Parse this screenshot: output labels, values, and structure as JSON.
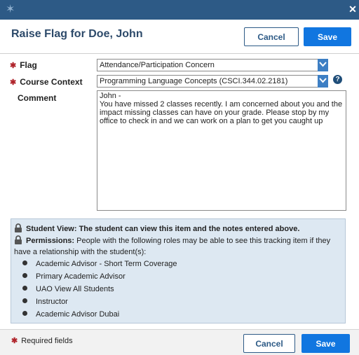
{
  "dialog": {
    "title": "Raise Flag for Doe, John",
    "cancel_label": "Cancel",
    "save_label": "Save"
  },
  "form": {
    "flag_label": "Flag",
    "flag_value": "Attendance/Participation Concern",
    "course_label": "Course Context",
    "course_value": "Programming Language Concepts (CSCI.344.02.2181)",
    "help_glyph": "?",
    "comment_label": "Comment",
    "comment_value": "John -\nYou have missed 2 classes recently. I am concerned about you and the impact missing classes can have on your grade. Please stop by my office to check in and we can work on a plan to get you caught up"
  },
  "info": {
    "student_view_text": "Student View: The student can view this item and the notes entered above.",
    "permissions_heading": "Permissions:",
    "permissions_text": " People with the following roles may be able to see this tracking item if they have a relationship with the student(s):",
    "roles": [
      "Academic Advisor - Short Term Coverage",
      "Primary Academic Advisor",
      "UAO View All Students",
      "Instructor",
      "Academic Advisor Dubai"
    ]
  },
  "footer": {
    "required_note": "Required fields",
    "cancel_label": "Cancel",
    "save_label": "Save"
  },
  "icons": {
    "required": "asterisk-icon",
    "chevron": "chevron-down-icon",
    "help": "help-icon",
    "lock": "lock-icon",
    "app": "app-logo-icon",
    "close": "close-icon"
  },
  "colors": {
    "titlebar": "#2d5a86",
    "title_text": "#2d4a6a",
    "primary_button": "#1176e0",
    "required": "#b0252c",
    "info_panel": "#dde8f2",
    "select_chevron": "#3d7fc4"
  }
}
